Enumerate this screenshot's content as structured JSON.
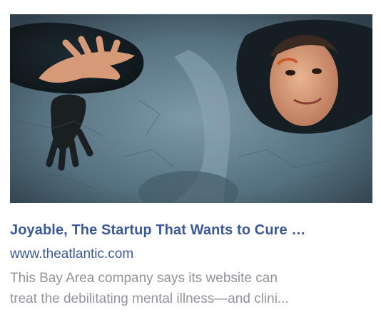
{
  "link_preview": {
    "image_alt": "Face peeking through hole in large gray sculpture",
    "title": "Joyable, The Startup That Wants to Cure …",
    "domain": "www.theatlantic.com",
    "description_lines": [
      "This Bay Area company says its website can",
      "treat the debilitating mental illness—and clini..."
    ]
  }
}
